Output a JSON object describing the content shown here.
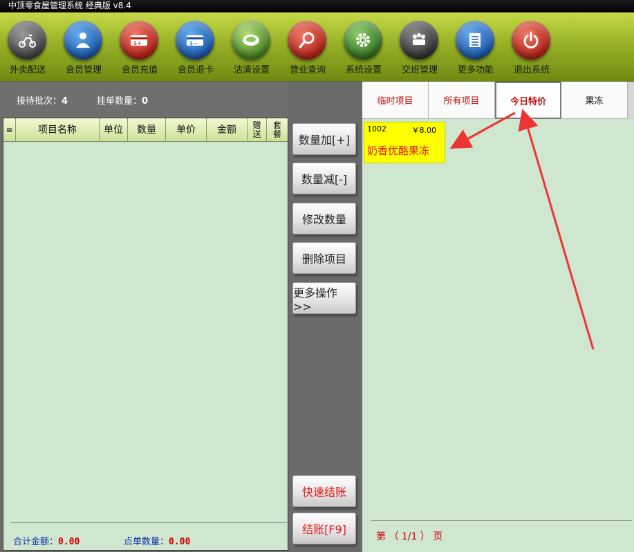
{
  "window": {
    "title": "中顶零食屋管理系统 经典版 v8.4"
  },
  "toolbar": {
    "items": [
      {
        "label": "外卖配送",
        "icon": "scooter-icon",
        "color": "gray"
      },
      {
        "label": "会员管理",
        "icon": "user-icon",
        "color": "blue"
      },
      {
        "label": "会员充值",
        "icon": "card-plus-icon",
        "color": "red"
      },
      {
        "label": "会员退卡",
        "icon": "card-minus-icon",
        "color": "blue"
      },
      {
        "label": "沽清设置",
        "icon": "plate-icon",
        "color": "green"
      },
      {
        "label": "营业查询",
        "icon": "magnifier-icon",
        "color": "red"
      },
      {
        "label": "系统设置",
        "icon": "gear-icon",
        "color": "dgreen"
      },
      {
        "label": "交班管理",
        "icon": "people-icon",
        "color": "dgray"
      },
      {
        "label": "更多功能",
        "icon": "list-icon",
        "color": "blue"
      },
      {
        "label": "退出系统",
        "icon": "power-icon",
        "color": "red"
      }
    ]
  },
  "left": {
    "waiting_label": "接待批次：",
    "waiting_value": "4",
    "hold_label": "挂单数量：",
    "hold_value": "0",
    "columns": [
      "≡",
      "项目名称",
      "单位",
      "数量",
      "单价",
      "金额",
      "赠送",
      "套餐"
    ],
    "total_label": "合计金额：",
    "total_value": "0.00",
    "count_label": "点单数量：",
    "count_value": "0.00"
  },
  "actions": {
    "qty_add": "数量加[+]",
    "qty_sub": "数量减[-]",
    "edit_qty": "修改数量",
    "delete_item": "删除项目",
    "more_ops": "更多操作>>",
    "quick_checkout": "快速结账",
    "checkout": "结账[F9]"
  },
  "right": {
    "tabs": [
      "临时项目",
      "所有项目",
      "今日特价",
      "果冻"
    ],
    "active_tab": "今日特价",
    "products": [
      {
        "code": "1002",
        "price": "￥8.00",
        "name": "奶香优酪果冻"
      }
    ],
    "pager": "第 （ 1/1 ） 页"
  },
  "colors": {
    "accent_red": "#e11b1b",
    "panel_green": "#cfe6cf",
    "toolbar_green": "#99b227",
    "highlight_yellow": "#ffff00"
  }
}
